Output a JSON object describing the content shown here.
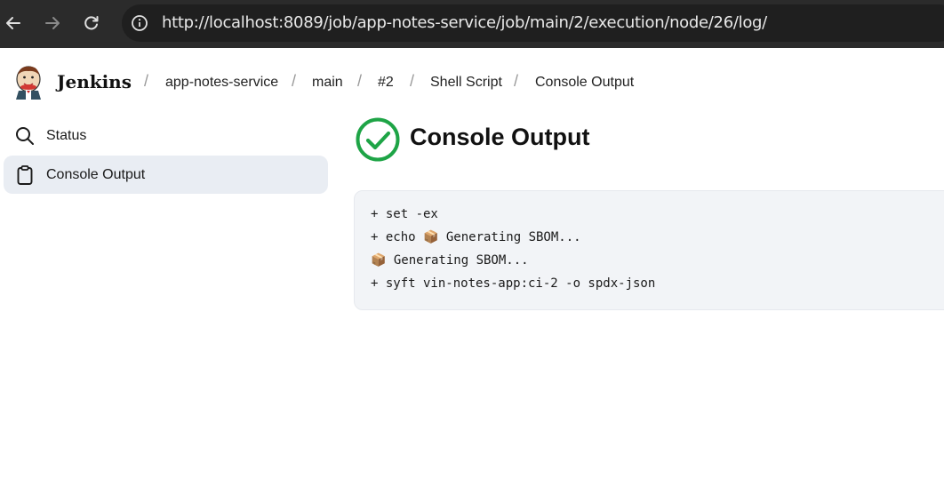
{
  "browser": {
    "url": "http://localhost:8089/job/app-notes-service/job/main/2/execution/node/26/log/",
    "icons": [
      "back-icon",
      "forward-icon",
      "reload-icon",
      "info-icon"
    ]
  },
  "header": {
    "brand": "Jenkins",
    "breadcrumbs": [
      {
        "label": "app-notes-service"
      },
      {
        "label": "main"
      },
      {
        "label": "#2"
      },
      {
        "label": "Shell Script"
      },
      {
        "label": "Console Output"
      }
    ],
    "separator": "/"
  },
  "sidebar": {
    "items": [
      {
        "label": "Status",
        "icon": "search-icon",
        "active": false
      },
      {
        "label": "Console Output",
        "icon": "clipboard-icon",
        "active": true
      }
    ]
  },
  "main": {
    "title": "Console Output",
    "status": "success",
    "status_color": "#1ea446",
    "console_lines": [
      "+ set -ex",
      "+ echo 📦 Generating SBOM...",
      "📦 Generating SBOM...",
      "+ syft vin-notes-app:ci-2 -o spdx-json"
    ]
  }
}
